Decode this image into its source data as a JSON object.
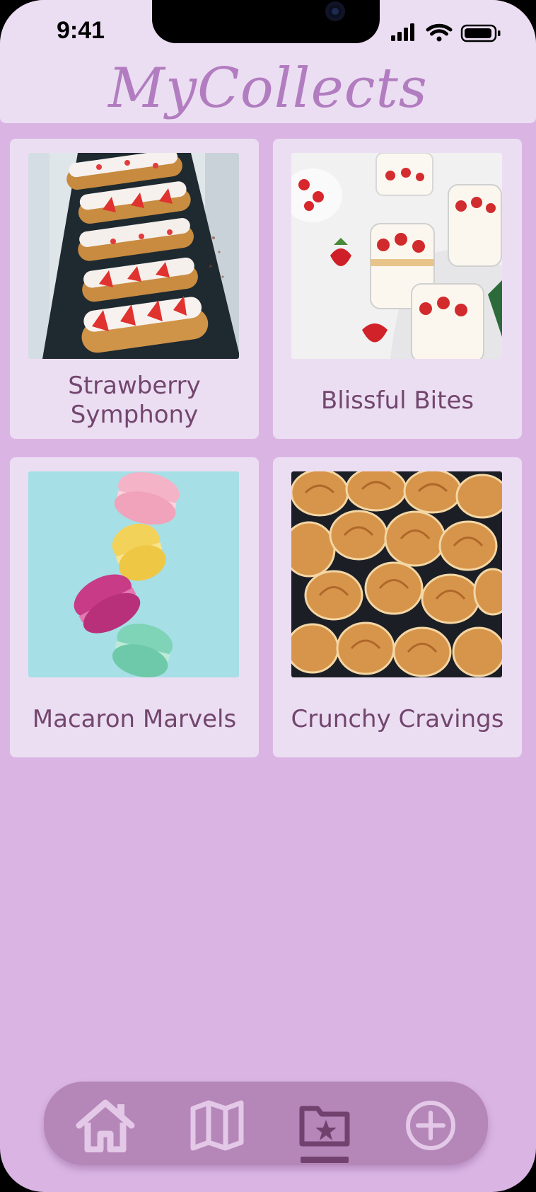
{
  "status_bar": {
    "time": "9:41"
  },
  "header": {
    "title": "MyCollects"
  },
  "collections": [
    {
      "label": "Strawberry Symphony",
      "image": "strawberry-eclairs"
    },
    {
      "label": "Blissful Bites",
      "image": "strawberry-panna-cotta-jars"
    },
    {
      "label": "Macaron Marvels",
      "image": "falling-macarons"
    },
    {
      "label": "Crunchy Cravings",
      "image": "palmier-cookies"
    }
  ],
  "bottom_nav": {
    "items": [
      {
        "icon": "home-icon",
        "active": false
      },
      {
        "icon": "map-icon",
        "active": false
      },
      {
        "icon": "collections-folder-star-icon",
        "active": true
      },
      {
        "icon": "add-circle-icon",
        "active": false
      }
    ]
  },
  "colors": {
    "background": "#dab5e4",
    "header_bg": "#ecdef2",
    "card_bg": "#ecdef2",
    "title": "#b27dc0",
    "card_text": "#72466e",
    "nav_bg": "#b586b8",
    "nav_icon": "#e3c8e8",
    "nav_active_icon": "#71426e"
  }
}
